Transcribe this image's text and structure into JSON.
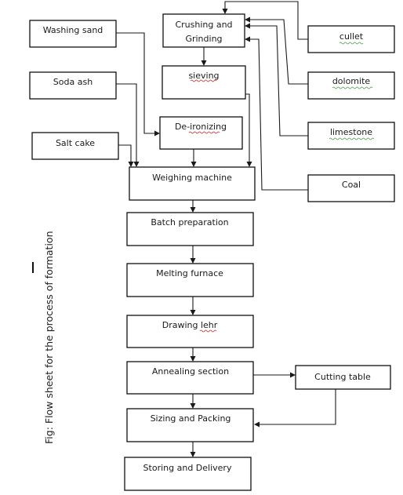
{
  "diagram": {
    "type": "flowchart",
    "caption": "Fig:  Flow sheet for the process of formation",
    "nodes": {
      "washing_sand": "Washing sand",
      "soda_ash": "Soda ash",
      "salt_cake": "Salt cake",
      "crushing_1": "Crushing and",
      "crushing_2": "Grinding",
      "sieving": "sieving",
      "de_ironizing": "De-ironizing",
      "weighing": "Weighing machine",
      "batch": "Batch preparation",
      "melting": "Melting furnace",
      "drawing": "Drawing lehr",
      "annealing": "Annealing section",
      "cutting": "Cutting table",
      "sizing": "Sizing and Packing",
      "storing": "Storing and Delivery",
      "cullet": "cullet",
      "dolomite": "dolomite",
      "limestone": "limestone",
      "coal": "Coal"
    },
    "edges": [
      [
        "cullet",
        "crushing"
      ],
      [
        "dolomite",
        "crushing"
      ],
      [
        "limestone",
        "crushing"
      ],
      [
        "coal",
        "crushing"
      ],
      [
        "crushing",
        "sieving"
      ],
      [
        "sieving",
        "weighing"
      ],
      [
        "washing_sand",
        "de_ironizing"
      ],
      [
        "de_ironizing",
        "weighing"
      ],
      [
        "soda_ash",
        "weighing"
      ],
      [
        "salt_cake",
        "weighing"
      ],
      [
        "weighing",
        "batch"
      ],
      [
        "batch",
        "melting"
      ],
      [
        "melting",
        "drawing"
      ],
      [
        "drawing",
        "annealing"
      ],
      [
        "annealing",
        "cutting"
      ],
      [
        "annealing",
        "sizing"
      ],
      [
        "cutting",
        "sizing"
      ],
      [
        "sizing",
        "storing"
      ]
    ]
  }
}
